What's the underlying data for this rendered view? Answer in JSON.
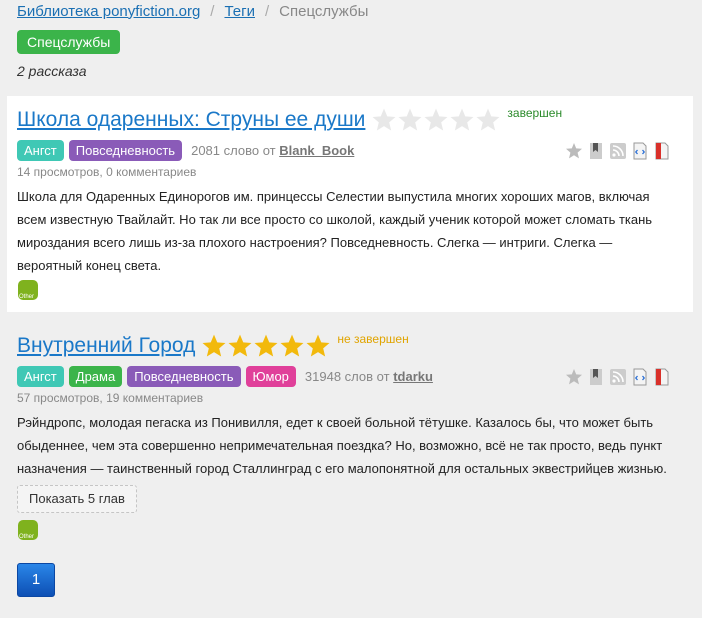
{
  "breadcrumb": {
    "home": "Библиотека ponyfiction.org",
    "tags": "Теги",
    "current": "Спецслужбы",
    "sep": "/"
  },
  "tag_label": "Спецслужбы",
  "story_count": "2 рассказа",
  "stories": [
    {
      "title": "Школа одаренных: Струны ее души",
      "rating": 0,
      "status": "завершен",
      "tags": [
        "Ангст",
        "Повседневность"
      ],
      "words": "2081 слово от",
      "author": "Blank_Book",
      "stats": "14 просмотров, 0 комментариев",
      "desc": "Школа для Одаренных Единорогов им. принцессы Селестии выпустила многих хороших магов, включая всем известную Твайлайт. Но так ли все просто со школой, каждый ученик которой может сломать ткань мироздания всего лишь из-за плохого настроения? Повседневность. Слегка — интриги. Слегка — вероятный конец света.",
      "icon": "other-icon"
    },
    {
      "title": "Внутренний Город",
      "rating": 5,
      "status": "не завершен",
      "tags": [
        "Ангст",
        "Драма",
        "Повседневность",
        "Юмор"
      ],
      "words": "31948 слов от",
      "author": "tdarku",
      "stats": "57 просмотров, 19 комментариев",
      "desc": "Рэйндропс, молодая пегаска из Понивилля, едет к своей больной тётушке. Казалось бы, что может быть обыденнее, чем эта совершенно непримечательная поездка? Но, возможно, всё не так просто, ведь пункт назначения — таинственный город Сталлинград с его малопонятной для остальных эквестрийцев жизнью.",
      "chapters_button": "Показать 5 глав",
      "icon": "other-icon"
    }
  ],
  "icon_text": "Other",
  "pager": {
    "current": "1"
  },
  "colors": {
    "link": "#1a78c8",
    "angst": "#3fc8b5",
    "daily": "#8a5bb8",
    "drama": "#3bb44a",
    "humor": "#e0409a",
    "star_on": "#f2b90c",
    "star_off": "#e6e6e6"
  }
}
